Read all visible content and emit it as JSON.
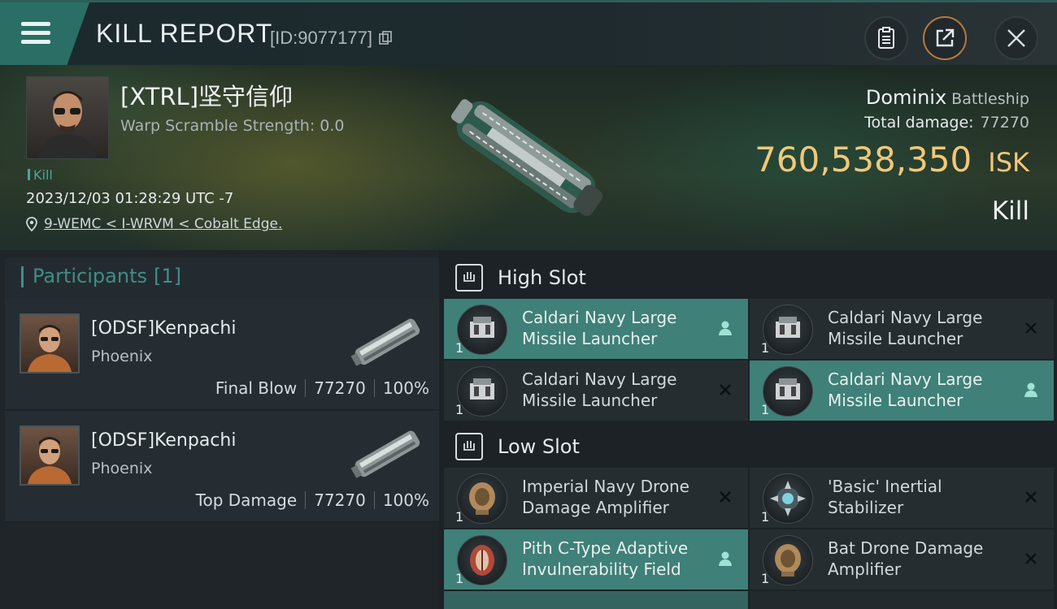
{
  "header": {
    "title": "KILL REPORT",
    "report_id": "[ID:9077177]"
  },
  "victim": {
    "name": "[XTRL]坚守信仰",
    "warp_scramble": "Warp Scramble Strength: 0.0",
    "tag": "Kill",
    "datetime": "2023/12/03 01:28:29 UTC -7",
    "location": "9-WEMC < I-WRVM < Cobalt Edge."
  },
  "ship": {
    "name": "Dominix",
    "class": "Battleship",
    "total_damage_label": "Total damage:",
    "total_damage_value": "77270",
    "isk_value": "760,538,350",
    "isk_unit": "ISK",
    "result": "Kill"
  },
  "participants": {
    "label": "Participants",
    "count": "[1]",
    "items": [
      {
        "name": "[ODSF]Kenpachi",
        "ship": "Phoenix",
        "role": "Final Blow",
        "damage": "77270",
        "percent": "100%"
      },
      {
        "name": "[ODSF]Kenpachi",
        "ship": "Phoenix",
        "role": "Top Damage",
        "damage": "77270",
        "percent": "100%"
      }
    ]
  },
  "slots": {
    "high": {
      "title": "High Slot",
      "modules": [
        {
          "name": "Caldari Navy Large Missile Launcher",
          "qty": "1",
          "status": "dropped"
        },
        {
          "name": "Caldari Navy Large Missile Launcher",
          "qty": "1",
          "status": "destroyed"
        },
        {
          "name": "Caldari Navy Large Missile Launcher",
          "qty": "1",
          "status": "destroyed"
        },
        {
          "name": "Caldari Navy Large Missile Launcher",
          "qty": "1",
          "status": "dropped"
        }
      ]
    },
    "low": {
      "title": "Low Slot",
      "modules": [
        {
          "name": "Imperial Navy Drone Damage Amplifier",
          "qty": "1",
          "status": "destroyed"
        },
        {
          "name": "'Basic' Inertial Stabilizer",
          "qty": "1",
          "status": "destroyed"
        },
        {
          "name": "Pith C-Type Adaptive Invulnerability Field",
          "qty": "1",
          "status": "dropped"
        },
        {
          "name": "Bat Drone Damage Amplifier",
          "qty": "1",
          "status": "destroyed"
        }
      ]
    }
  },
  "icons": {
    "menu": "menu-icon",
    "clipboard": "clipboard-icon",
    "share": "share-icon",
    "close": "close-icon",
    "copy": "copy-icon",
    "location": "location-pin-icon",
    "dropped": "person-icon",
    "destroyed": "x-icon"
  },
  "colors": {
    "accent": "#3f8079",
    "isk": "#f1c878",
    "share_ring": "#b8793a"
  }
}
